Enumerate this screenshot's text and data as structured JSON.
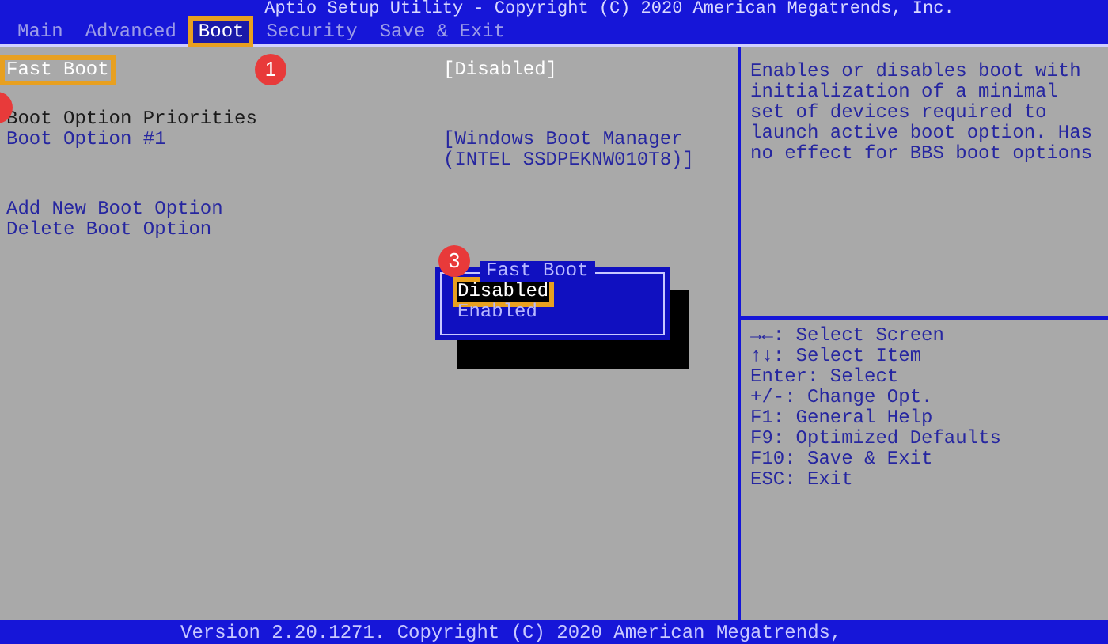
{
  "header": {
    "title": "Aptio Setup Utility - Copyright (C) 2020 American Megatrends, Inc."
  },
  "tabs": [
    {
      "label": "Main",
      "selected": false,
      "annotated": false
    },
    {
      "label": "Advanced",
      "selected": false,
      "annotated": false
    },
    {
      "label": "Boot",
      "selected": true,
      "annotated": true
    },
    {
      "label": "Security",
      "selected": false,
      "annotated": false
    },
    {
      "label": "Save & Exit",
      "selected": false,
      "annotated": false
    }
  ],
  "sections": [
    {
      "items": [
        {
          "kind": "item",
          "label": "Fast Boot",
          "value_lines": [
            "[Disabled]"
          ],
          "selected": true,
          "annotated": true
        }
      ]
    },
    {
      "items": [
        {
          "kind": "heading",
          "label": "Boot Option Priorities",
          "selected": false,
          "annotated": false
        },
        {
          "kind": "item",
          "label": "Boot Option #1",
          "value_lines": [
            "[Windows Boot Manager",
            "(INTEL SSDPEKNW010T8)]"
          ],
          "selected": false,
          "annotated": false
        }
      ]
    },
    {
      "items": [
        {
          "kind": "item",
          "label": "Add New Boot Option",
          "selected": false,
          "annotated": false
        },
        {
          "kind": "item",
          "label": "Delete Boot Option",
          "selected": false,
          "annotated": false
        }
      ]
    }
  ],
  "popup": {
    "title": "Fast Boot",
    "options": [
      {
        "label": "Disabled",
        "selected": true,
        "annotated": true
      },
      {
        "label": "Enabled",
        "selected": false,
        "annotated": false
      }
    ]
  },
  "help": {
    "description_lines": [
      "Enables or disables boot with",
      "initialization of a minimal",
      "set of devices required to",
      "launch active boot option. Has",
      "no effect for BBS boot options"
    ],
    "keys": [
      "→←: Select Screen",
      "↑↓: Select Item",
      "Enter: Select",
      "+/-: Change Opt.",
      "F1: General Help",
      "F9: Optimized Defaults",
      "F10: Save & Exit",
      "ESC: Exit"
    ]
  },
  "markers": [
    {
      "kind": "numbered",
      "label": "1"
    },
    {
      "kind": "edge"
    },
    {
      "kind": "numbered",
      "label": "3"
    }
  ],
  "footer": {
    "text": "Version 2.20.1271. Copyright (C) 2020 American Megatrends,"
  }
}
